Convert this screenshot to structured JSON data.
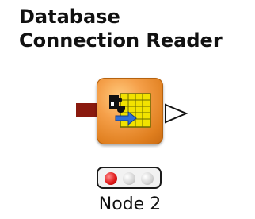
{
  "node": {
    "title_line1": "Database",
    "title_line2": "Connection Reader",
    "label": "Node 2",
    "icon": "database-reader-icon",
    "colors": {
      "body": "#e8892a",
      "input_port": "#8a1a0e",
      "status_red": "#e01a1a"
    }
  }
}
